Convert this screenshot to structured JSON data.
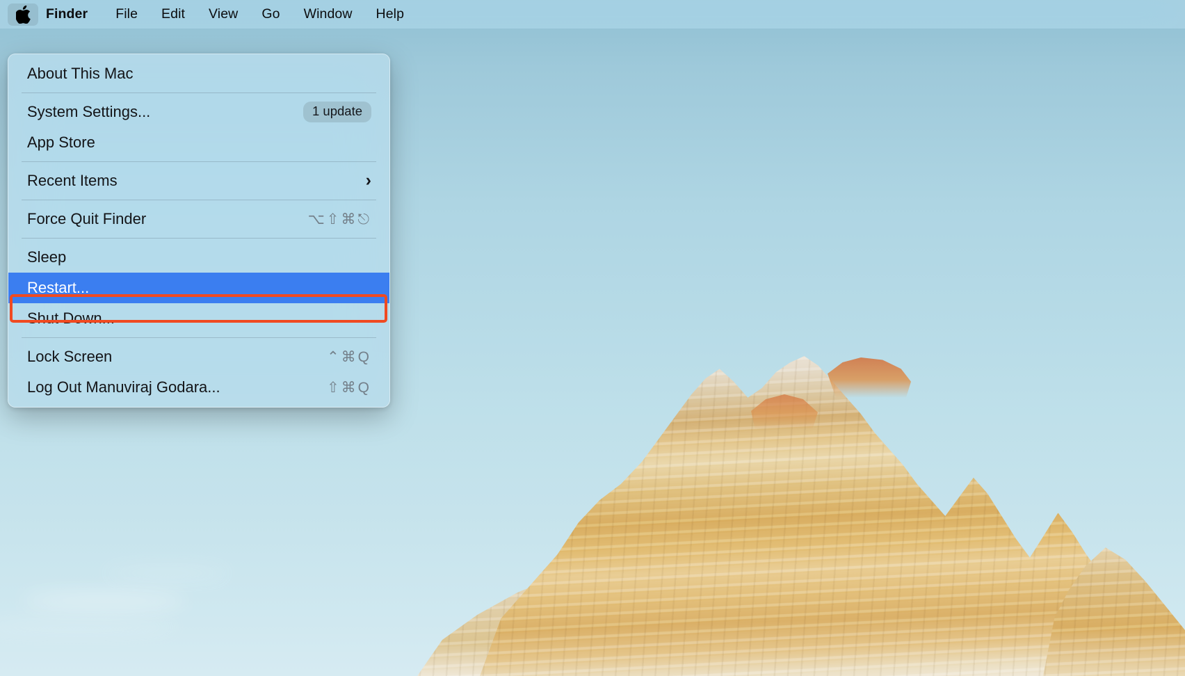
{
  "menubar": {
    "apple_icon": "apple-logo-icon",
    "items": [
      {
        "label": "Finder",
        "bold": true
      },
      {
        "label": "File",
        "bold": false
      },
      {
        "label": "Edit",
        "bold": false
      },
      {
        "label": "View",
        "bold": false
      },
      {
        "label": "Go",
        "bold": false
      },
      {
        "label": "Window",
        "bold": false
      },
      {
        "label": "Help",
        "bold": false
      }
    ]
  },
  "apple_menu": {
    "items": {
      "about_this_mac": "About This Mac",
      "system_settings": "System Settings...",
      "system_settings_badge": "1 update",
      "app_store": "App Store",
      "recent_items": "Recent Items",
      "recent_items_chevron": "›",
      "force_quit": "Force Quit Finder",
      "force_quit_shortcut": "⌥⇧⌘⎋",
      "sleep": "Sleep",
      "restart": "Restart...",
      "shut_down": "Shut Down...",
      "lock_screen": "Lock Screen",
      "lock_screen_shortcut": "⌃⌘Q",
      "log_out": "Log Out Manuviraj Godara...",
      "log_out_shortcut": "⇧⌘Q"
    }
  },
  "colors": {
    "selection_blue": "#3b7ef0",
    "annotation_red": "#f04a21",
    "menubar_tint": "#b0d6e6",
    "menu_tint": "#b9dae9"
  }
}
